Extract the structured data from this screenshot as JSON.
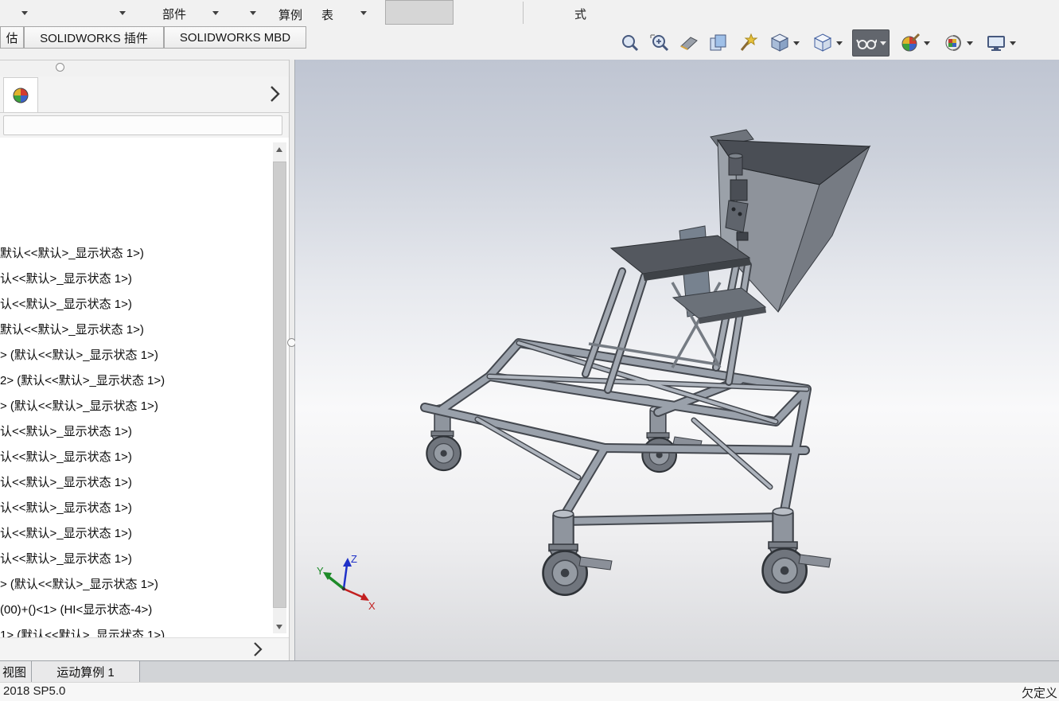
{
  "ribbon": {
    "component_label": "部件",
    "study_label": "算例",
    "table_label": "表",
    "mode_label": "式"
  },
  "command_tabs": {
    "items": [
      "估",
      "SOLIDWORKS 插件",
      "SOLIDWORKS MBD"
    ]
  },
  "view_toolbar": {
    "icons": [
      "zoom-to-fit",
      "zoom-to-area",
      "section-view",
      "copy-appearance",
      "filter",
      "view-orientation",
      "display-style",
      "hide-show-items",
      "edit-appearance",
      "apply-scene",
      "view-settings"
    ],
    "pressed_icon": "hide-show-items"
  },
  "feature_tree": {
    "items": [
      "默认<<默认>_显示状态 1>)",
      "认<<默认>_显示状态 1>)",
      "认<<默认>_显示状态 1>)",
      "默认<<默认>_显示状态 1>)",
      "> (默认<<默认>_显示状态 1>)",
      "2> (默认<<默认>_显示状态 1>)",
      "> (默认<<默认>_显示状态 1>)",
      "认<<默认>_显示状态 1>)",
      "认<<默认>_显示状态 1>)",
      "认<<默认>_显示状态 1>)",
      "认<<默认>_显示状态 1>)",
      "认<<默认>_显示状态 1>)",
      "认<<默认>_显示状态 1>)",
      "> (默认<<默认>_显示状态 1>)",
      "(00)+()<1> (HI<显示状态-4>)",
      "1> (默认<<默认>_显示状态 1>)"
    ]
  },
  "viewport": {
    "triad": {
      "x_label": "X",
      "y_label": "Y",
      "z_label": "Z"
    }
  },
  "motion_bar": {
    "tabs": [
      "视图",
      "运动算例 1"
    ]
  },
  "status_bar": {
    "left": "2018 SP5.0",
    "right": "欠定义"
  },
  "colors": {
    "viewport_gradient_top": "#bfc5d2",
    "viewport_gradient_bottom": "#d9dadd",
    "steel": "#9aa1ab",
    "steel_dark": "#44484f",
    "hopper_dark": "#4a4e55",
    "triad_x": "#c21f1f",
    "triad_y": "#1d8a28",
    "triad_z": "#1f31c8"
  }
}
